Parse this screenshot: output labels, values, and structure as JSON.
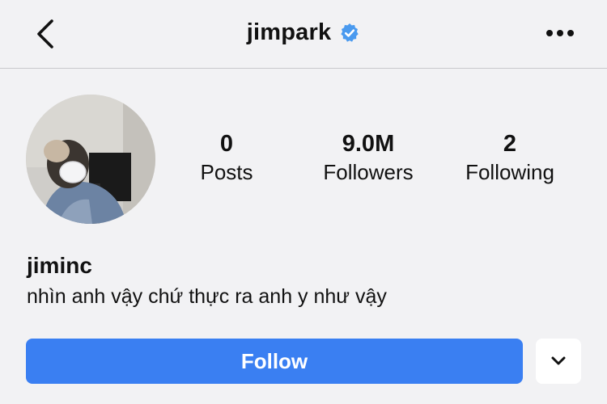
{
  "header": {
    "username": "jimpark",
    "verified_icon": "verified-badge-icon",
    "back_icon": "chevron-left-icon",
    "more_icon": "ellipsis-icon"
  },
  "stats": [
    {
      "value": "0",
      "label": "Posts"
    },
    {
      "value": "9.0M",
      "label": "Followers"
    },
    {
      "value": "2",
      "label": "Following"
    }
  ],
  "profile": {
    "name": "jiminc",
    "bio": "nhìn anh vậy chứ thực ra anh y như vậy"
  },
  "actions": {
    "follow_label": "Follow",
    "dropdown_icon": "chevron-down-icon"
  },
  "colors": {
    "accent": "#3a7ff2",
    "verified": "#4a9aef",
    "background": "#f2f2f4"
  }
}
